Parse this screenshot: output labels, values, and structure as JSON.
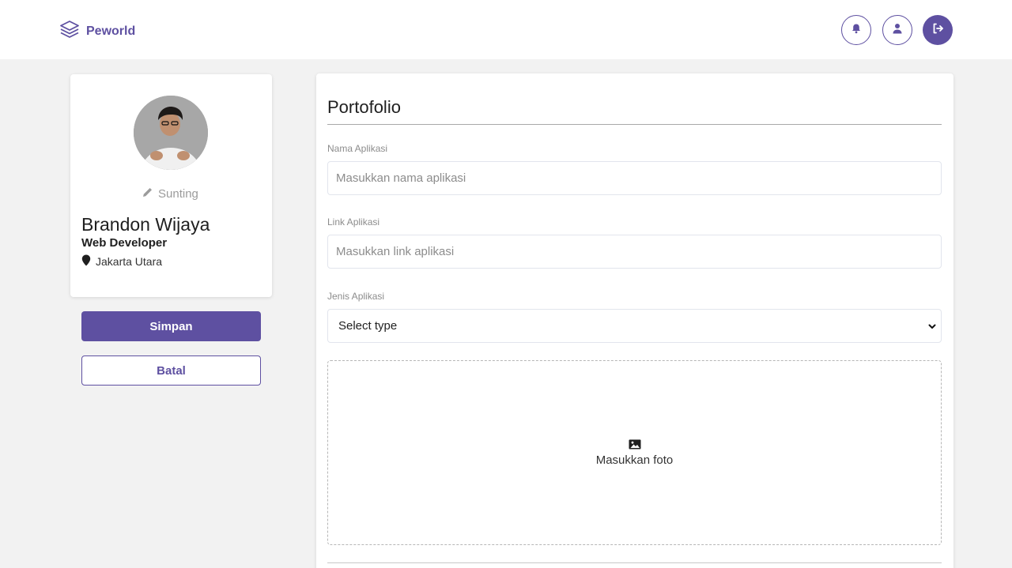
{
  "colors": {
    "accent": "#5e50a1",
    "background": "#f2f2f2",
    "card": "#ffffff",
    "muted_text": "#8c8c8c"
  },
  "navbar": {
    "brand": {
      "name": "Peworld",
      "icon": "layers-icon"
    },
    "actions": [
      {
        "icon": "bell-icon"
      },
      {
        "icon": "user-icon"
      },
      {
        "icon": "logout-icon"
      }
    ]
  },
  "profile": {
    "avatar_icon": "profile-photo",
    "edit_label": "Sunting",
    "edit_icon": "pencil-icon",
    "name": "Brandon Wijaya",
    "role": "Web Developer",
    "location": "Jakarta Utara",
    "location_icon": "map-pin-icon"
  },
  "buttons": {
    "save": "Simpan",
    "cancel": "Batal"
  },
  "form": {
    "title": "Portofolio",
    "app_name": {
      "label": "Nama Aplikasi",
      "placeholder": "Masukkan nama aplikasi",
      "value": ""
    },
    "app_link": {
      "label": "Link Aplikasi",
      "placeholder": "Masukkan link aplikasi",
      "value": ""
    },
    "app_type": {
      "label": "Jenis Aplikasi",
      "selected": "Select type",
      "icon": "chevron-down-icon"
    },
    "upload": {
      "label": "Masukkan foto",
      "icon": "image-icon"
    }
  }
}
